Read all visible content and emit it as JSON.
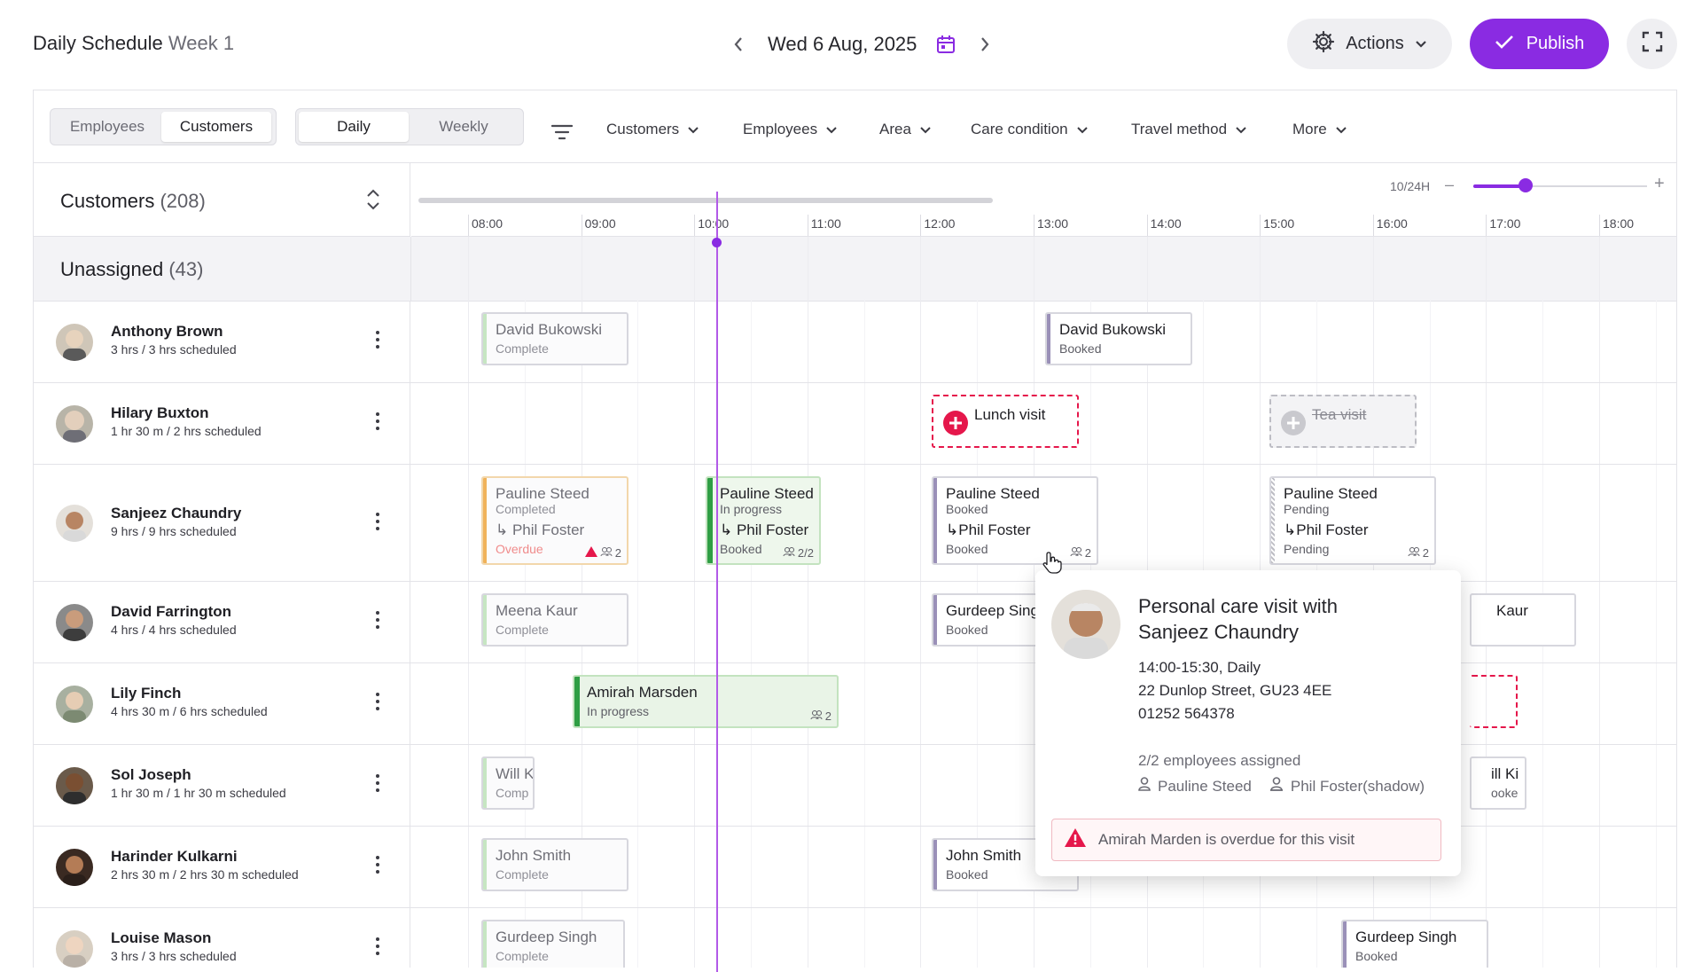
{
  "header": {
    "title": "Daily Schedule",
    "week": "Week 1",
    "date": "Wed 6 Aug, 2025",
    "actions_label": "Actions",
    "publish_label": "Publish"
  },
  "filters": {
    "view_toggle": [
      "Employees",
      "Customers"
    ],
    "view_selected": "Customers",
    "range_toggle": [
      "Daily",
      "Weekly"
    ],
    "range_selected": "Daily",
    "dropdowns": [
      "Customers",
      "Employees",
      "Area",
      "Care condition",
      "Travel method",
      "More"
    ]
  },
  "left_header": {
    "label": "Customers",
    "count": "(208)"
  },
  "unassigned": {
    "label": "Unassigned",
    "count": "(43)"
  },
  "timeline": {
    "zoom_label": "10/24H",
    "zoom_value": 0.3,
    "hours": [
      "08:00",
      "09:00",
      "10:00",
      "11:00",
      "12:00",
      "13:00",
      "14:00",
      "15:00",
      "16:00",
      "17:00",
      "18:00"
    ],
    "now": "10:05"
  },
  "rows": [
    {
      "name": "Anthony Brown",
      "sub": "3 hrs / 3 hrs scheduled"
    },
    {
      "name": "Hilary Buxton",
      "sub": "1 hr 30 m / 2 hrs scheduled"
    },
    {
      "name": "Sanjeez Chaundry",
      "sub": "9 hrs / 9 hrs scheduled"
    },
    {
      "name": "David Farrington",
      "sub": "4 hrs / 4 hrs scheduled"
    },
    {
      "name": "Lily Finch",
      "sub": "4 hrs 30 m / 6 hrs scheduled"
    },
    {
      "name": "Sol Joseph",
      "sub": "1 hr 30 m / 1 hr 30 m scheduled"
    },
    {
      "name": "Harinder Kulkarni",
      "sub": "2 hrs 30 m / 2 hrs 30 m scheduled"
    },
    {
      "name": "Louise Mason",
      "sub": "3 hrs / 3 hrs scheduled"
    }
  ],
  "cards": {
    "ab1": {
      "name": "David Bukowski",
      "status": "Complete"
    },
    "ab2": {
      "name": "David Bukowski",
      "status": "Booked"
    },
    "hb1": {
      "name": "Lunch visit"
    },
    "hb2": {
      "name": "Tea visit"
    },
    "sc1": {
      "name": "Pauline Steed",
      "status": "Completed",
      "name2": "Phil Foster",
      "status2": "Overdue",
      "count": "2"
    },
    "sc2": {
      "name": "Pauline Steed",
      "status": "In progress",
      "name2": "Phil Foster",
      "status2": "Booked",
      "count": "2/2"
    },
    "sc3": {
      "name": "Pauline Steed",
      "status": "Booked",
      "name2": "Phil Foster",
      "status2": "Booked",
      "count": "2"
    },
    "sc4": {
      "name": "Pauline Steed",
      "status": "Pending",
      "name2": "Phil Foster",
      "status2": "Pending",
      "count": "2"
    },
    "df1": {
      "name": "Meena Kaur",
      "status": "Complete"
    },
    "df2": {
      "name": "Gurdeep Singh",
      "status": "Booked"
    },
    "df3": {
      "name": "Kaur"
    },
    "lf1": {
      "name": "Amirah Marsden",
      "status": "In progress",
      "count": "2"
    },
    "sj1": {
      "name": "Will K",
      "status": "Comp"
    },
    "sj2": {
      "name": "ill Ki",
      "status": "ooke"
    },
    "hk1": {
      "name": "John Smith",
      "status": "Complete"
    },
    "hk2": {
      "name": "John Smith",
      "status": "Booked"
    },
    "lm1": {
      "name": "Gurdeep Singh",
      "status": "Complete"
    },
    "lm2": {
      "name": "Gurdeep Singh",
      "status": "Booked"
    }
  },
  "popup": {
    "title1": "Personal care visit with",
    "title2": "Sanjeez Chaundry",
    "time": "14:00-15:30, Daily",
    "address": "22 Dunlop Street, GU23 4EE",
    "phone": "01252 564378",
    "assigned": "2/2 employees assigned",
    "emp1": "Pauline Steed",
    "emp2": "Phil Foster",
    "emp2_note": "(shadow)",
    "warning": "Amirah Marden is overdue for this visit"
  },
  "colors": {
    "accent": "#8a2be2",
    "complete": "#c9e8c4",
    "progress": "#2f9e44",
    "overdue": "#f0b25a",
    "booked": "#9a90b8",
    "alert": "#e5174b"
  }
}
